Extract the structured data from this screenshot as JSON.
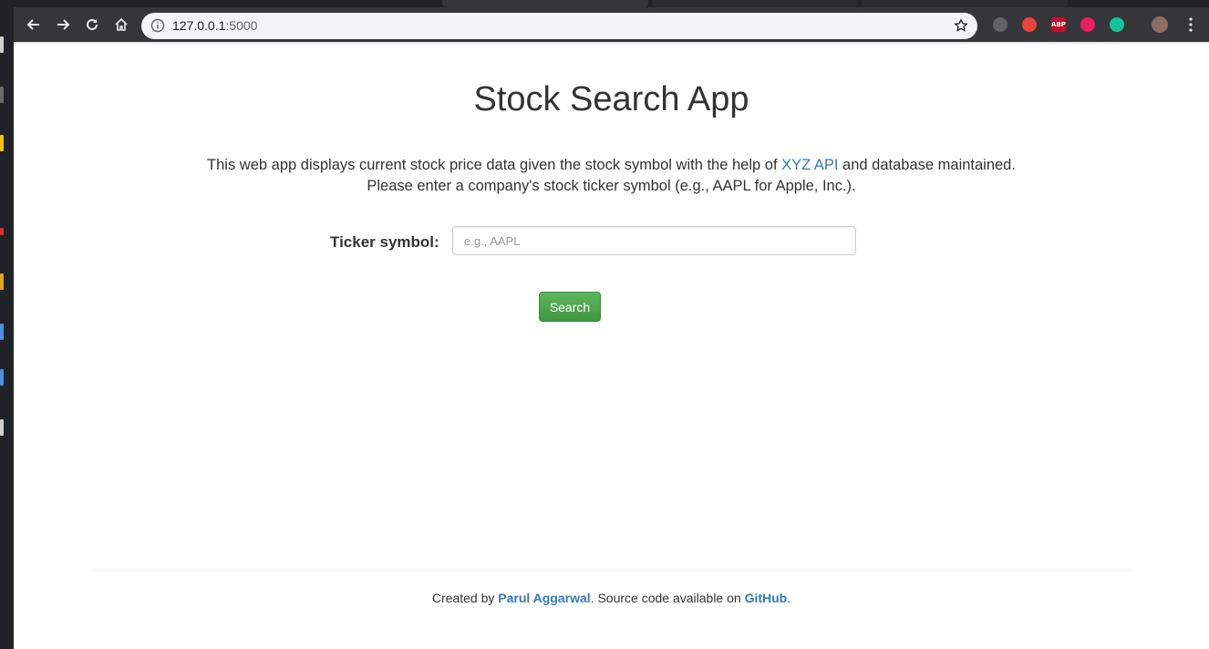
{
  "browser": {
    "url_host": "127.0.0.1",
    "url_port": ":5000",
    "extensions": [
      "mask-extension-icon",
      "shield-extension-icon",
      "adblock-extension-icon",
      "tumblr-extension-icon",
      "grammarly-extension-icon",
      "profile-avatar"
    ],
    "adblock_label": "ABP"
  },
  "page": {
    "title": "Stock Search App",
    "description_part1": "This web app displays current stock price data given the stock symbol with the help of ",
    "api_link": "XYZ API",
    "description_part2": " and database maintained.",
    "description_line2": "Please enter a company's stock ticker symbol (e.g., AAPL for Apple, Inc.).",
    "ticker_label": "Ticker symbol:",
    "ticker_placeholder": "e.g., AAPL",
    "ticker_value": "",
    "search_label": "Search"
  },
  "footer": {
    "created_by": "Created by ",
    "author": "Parul Aggarwal",
    "source_text": ". Source code available on ",
    "github": "GitHub",
    "end": "."
  },
  "colors": {
    "link": "#337ab7",
    "button": "#449d44",
    "toolbar": "#35363a"
  }
}
